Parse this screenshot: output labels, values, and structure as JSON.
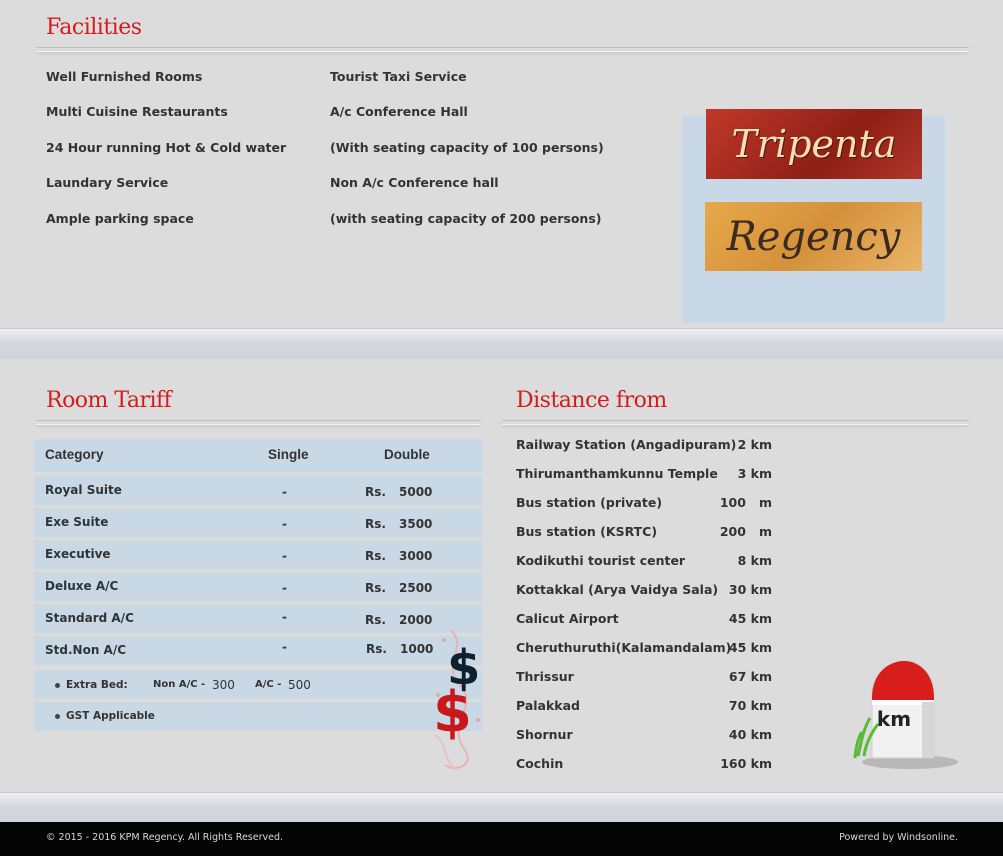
{
  "facilities": {
    "heading": "Facilities",
    "left_items": [
      "Well Furnished Rooms",
      "Multi Cuisine Restaurants",
      "24 Hour running Hot & Cold water",
      "Laundary Service",
      "Ample parking space"
    ],
    "right_items": [
      "Tourist Taxi Service",
      "A/c Conference Hall",
      "(With seating capacity of 100 persons)",
      "Non A/c Conference hall",
      "(with seating capacity of 200 persons)"
    ],
    "logo_line1": "Tripenta",
    "logo_line2": "Regency"
  },
  "tariff": {
    "heading": "Room Tariff",
    "columns": [
      "Category",
      "Single",
      "Double"
    ],
    "rows": [
      {
        "category": "Royal Suite",
        "single": "-",
        "currency": "Rs.",
        "double": "5000"
      },
      {
        "category": "Exe Suite",
        "single": "-",
        "currency": "Rs.",
        "double": "3500"
      },
      {
        "category": "Executive",
        "single": "-",
        "currency": "Rs.",
        "double": "3000"
      },
      {
        "category": "Deluxe A/C",
        "single": "-",
        "currency": "Rs.",
        "double": "2500"
      },
      {
        "category": "Standard A/C",
        "single": "-",
        "currency": "Rs.",
        "double": "2000"
      },
      {
        "category": "Std.Non A/C",
        "single": "-",
        "currency": "Rs.",
        "double": "1000"
      }
    ],
    "extra_bed_label": "Extra Bed:",
    "extra_bed_nonac_label": "Non A/C -",
    "extra_bed_nonac_value": "300",
    "extra_bed_ac_label": "A/C -",
    "extra_bed_ac_value": "500",
    "gst_note": "GST Applicable"
  },
  "distance": {
    "heading": "Distance from",
    "items": [
      {
        "place": "Railway Station (Angadipuram)",
        "value": "2 km"
      },
      {
        "place": "Thirumanthamkunnu Temple",
        "value": "3 km"
      },
      {
        "place": "Bus station (private)",
        "value": "100   m"
      },
      {
        "place": "Bus station (KSRTC)",
        "value": "200   m"
      },
      {
        "place": "Kodikuthi tourist center",
        "value": "8 km"
      },
      {
        "place": "Kottakkal (Arya Vaidya Sala)",
        "value": "30 km"
      },
      {
        "place": "Calicut Airport",
        "value": "45 km"
      },
      {
        "place": "Cheruthuruthi(Kalamandalam)",
        "value": "45 km"
      },
      {
        "place": "Thrissur",
        "value": "67 km"
      },
      {
        "place": "Palakkad",
        "value": "70 km"
      },
      {
        "place": "Shornur",
        "value": "40 km"
      },
      {
        "place": "Cochin",
        "value": "160 km"
      }
    ],
    "milestone_label": "km"
  },
  "footer": {
    "copyright": "© 2015 - 2016 KPM Regency. All Rights Reserved.",
    "credit": "Powered by Windsonline."
  },
  "colors": {
    "heading": "#d41c1c",
    "table_row": "#c8d8e4",
    "footer_bg": "#050505"
  }
}
